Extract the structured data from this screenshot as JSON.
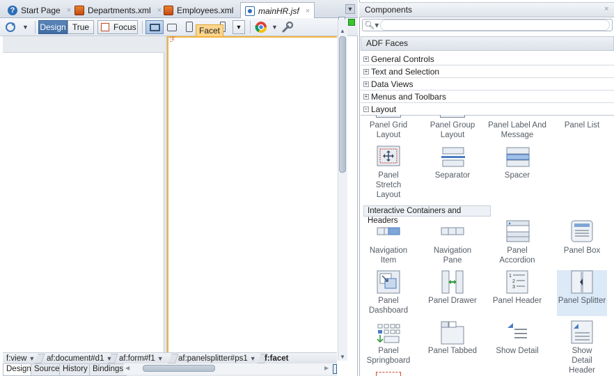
{
  "editor": {
    "tabs": [
      {
        "label": "Start Page",
        "icon": "help-icon"
      },
      {
        "label": "Departments.xml",
        "icon": "xml-file-icon"
      },
      {
        "label": "Employees.xml",
        "icon": "xml-file-icon"
      },
      {
        "label": "mainHR.jsf",
        "icon": "jsf-file-icon",
        "active": true
      }
    ],
    "toolbar": {
      "design_label": "Design",
      "true_label": "True",
      "focus_label": "Focus",
      "facet_tooltip": "Facet"
    },
    "breadcrumbs": [
      "f:view",
      "af:document#d1",
      "af:form#f1",
      "af:panelsplitter#ps1",
      "f:facet"
    ],
    "bottom_tabs": [
      "Design",
      "Source",
      "History",
      "Bindings"
    ],
    "caret": "ℱ"
  },
  "palette": {
    "title": "Components",
    "close": "×",
    "search_placeholder": "",
    "library": "ADF Faces",
    "categories": [
      {
        "label": "General Controls",
        "expanded": false
      },
      {
        "label": "Text and Selection",
        "expanded": false
      },
      {
        "label": "Data Views",
        "expanded": false
      },
      {
        "label": "Menus and Toolbars",
        "expanded": false
      },
      {
        "label": "Layout",
        "expanded": true
      }
    ],
    "layout_items": [
      {
        "label": "Panel Grid Layout"
      },
      {
        "label": "Panel Group Layout"
      },
      {
        "label": "Panel Label And Message"
      },
      {
        "label": "Panel List"
      },
      {
        "label": "Panel Stretch Layout"
      },
      {
        "label": "Separator"
      },
      {
        "label": "Spacer"
      }
    ],
    "section_header": "Interactive Containers and Headers",
    "interactive_items": [
      {
        "label": "Navigation Item"
      },
      {
        "label": "Navigation Pane"
      },
      {
        "label": "Panel Accordion"
      },
      {
        "label": "Panel Box"
      },
      {
        "label": "Panel Dashboard"
      },
      {
        "label": "Panel Drawer"
      },
      {
        "label": "Panel Header"
      },
      {
        "label": "Panel Splitter",
        "selected": true
      },
      {
        "label": "Panel Springboard"
      },
      {
        "label": "Panel Tabbed"
      },
      {
        "label": "Show Detail"
      },
      {
        "label": "Show Detail Header"
      }
    ]
  },
  "colors": {
    "accent_orange": "#f0b23a",
    "selection_blue": "#dce9f7",
    "toggle_blue": "#4a76ab"
  }
}
